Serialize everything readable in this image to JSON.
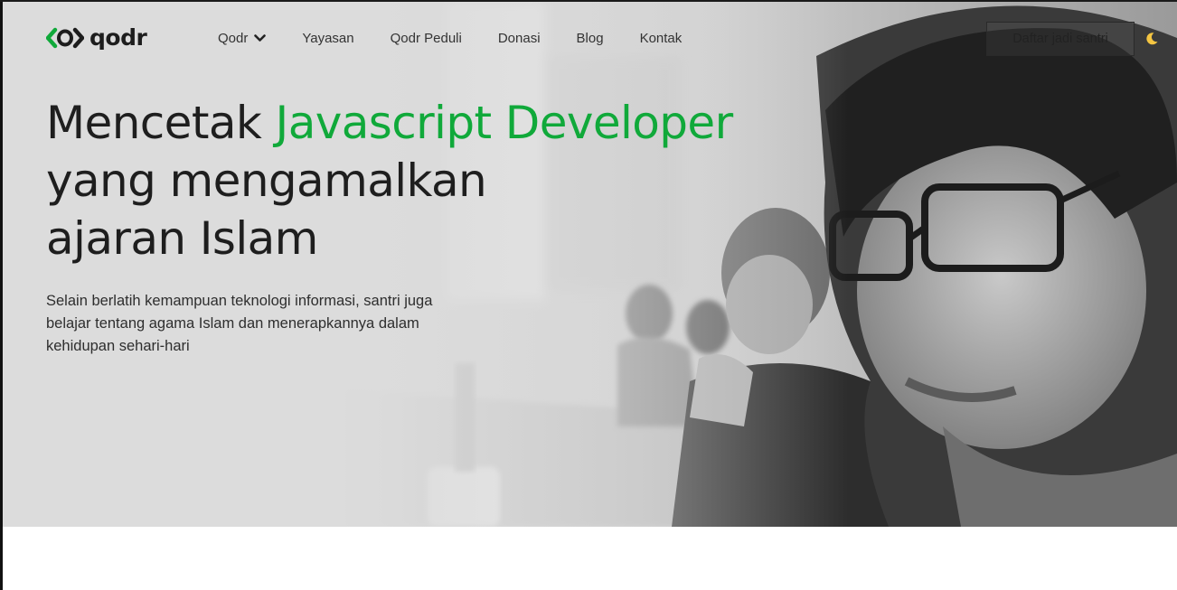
{
  "brand": {
    "name": "qodr",
    "accent_color": "#10a93a",
    "logo_icon": "code-brackets-icon"
  },
  "nav": {
    "items": [
      {
        "label": "Qodr",
        "has_dropdown": true
      },
      {
        "label": "Yayasan"
      },
      {
        "label": "Qodr Peduli"
      },
      {
        "label": "Donasi"
      },
      {
        "label": "Blog"
      },
      {
        "label": "Kontak"
      }
    ],
    "cta_label": "Daftar jadi santri",
    "theme_toggle_icon": "moon-icon"
  },
  "hero": {
    "headline_prefix": "Mencetak ",
    "headline_accent": "Javascript Developer",
    "headline_line2": "yang mengamalkan",
    "headline_line3": "ajaran Islam",
    "lede": "Selain berlatih kemampuan teknologi informasi, santri juga belajar tentang agama Islam dan menerapkannya dalam kehidupan sehari-hari",
    "image": "grayscale-photo-students-coding"
  }
}
